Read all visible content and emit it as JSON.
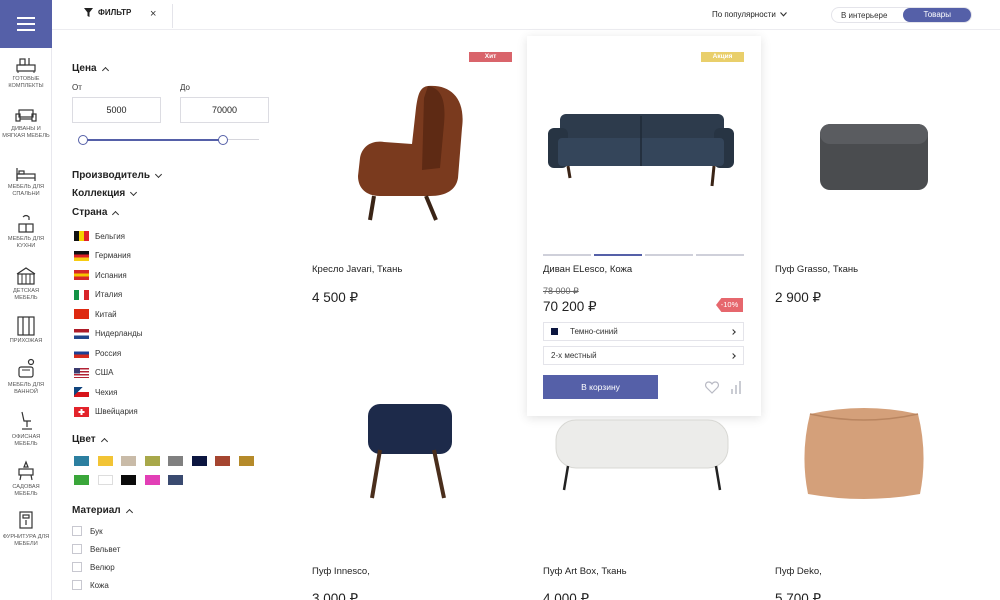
{
  "rail": {
    "items": [
      {
        "label": "ГОТОВЫЕ КОМПЛЕКТЫ",
        "icon": "set-icon"
      },
      {
        "label": "ДИВАНЫ И МЯГКАЯ МЕБЕЛЬ",
        "icon": "sofa-icon"
      },
      {
        "label": "МЕБЕЛЬ ДЛЯ СПАЛЬНИ",
        "icon": "bed-icon"
      },
      {
        "label": "МЕБЕЛЬ ДЛЯ КУХНИ",
        "icon": "kitchen-icon"
      },
      {
        "label": "ДЕТСКАЯ МЕБЕЛЬ",
        "icon": "kids-icon"
      },
      {
        "label": "ПРИХОЖАЯ",
        "icon": "hallway-icon"
      },
      {
        "label": "МЕБЕЛЬ ДЛЯ ВАННОЙ",
        "icon": "bath-icon"
      },
      {
        "label": "ОФИСНАЯ МЕБЕЛЬ",
        "icon": "office-chair-icon"
      },
      {
        "label": "САДОВАЯ МЕБЕЛЬ",
        "icon": "garden-icon"
      },
      {
        "label": "ФУРНИТУРА ДЛЯ МЕБЕЛИ",
        "icon": "hardware-icon"
      }
    ]
  },
  "topbar": {
    "filter_label": "ФИЛЬТР",
    "close": "×",
    "sort_label": "По популярности",
    "view_interior": "В интерьере",
    "view_products": "Товары"
  },
  "filters": {
    "price": {
      "title": "Цена",
      "from_label": "От",
      "to_label": "До",
      "from_value": "5000",
      "to_value": "70000",
      "slider_from_fraction": 0.0,
      "slider_to_fraction": 0.8
    },
    "manufacturer": "Производитель",
    "collection": "Коллекция",
    "country": {
      "title": "Страна",
      "items": [
        {
          "name": "Бельгия",
          "colors": [
            "#111111",
            "#f5d000",
            "#e0202a"
          ],
          "dir": "v"
        },
        {
          "name": "Германия",
          "colors": [
            "#111111",
            "#dd1f26",
            "#f7cc12"
          ],
          "dir": "h"
        },
        {
          "name": "Испания",
          "colors": [
            "#d62828",
            "#f5c400",
            "#d62828"
          ],
          "dir": "h"
        },
        {
          "name": "Италия",
          "colors": [
            "#139245",
            "#ffffff",
            "#d8242a"
          ],
          "dir": "v"
        },
        {
          "name": "Китай",
          "colors": [
            "#de2910"
          ],
          "dir": "h"
        },
        {
          "name": "Нидерланды",
          "colors": [
            "#ae1c28",
            "#ffffff",
            "#21468b"
          ],
          "dir": "h"
        },
        {
          "name": "Россия",
          "colors": [
            "#ffffff",
            "#1c3f94",
            "#d52b1e"
          ],
          "dir": "h"
        },
        {
          "name": "США",
          "colors": [
            "#b22234",
            "#ffffff",
            "#3c3b6e"
          ],
          "dir": "us"
        },
        {
          "name": "Чехия",
          "colors": [
            "#ffffff",
            "#d7141a",
            "#11457e"
          ],
          "dir": "cz"
        },
        {
          "name": "Швейцария",
          "colors": [
            "#e3242b"
          ],
          "dir": "ch"
        }
      ]
    },
    "color": {
      "title": "Цвет",
      "swatches": [
        "#2c7fa0",
        "#f2c435",
        "#c9bba8",
        "#a8a84a",
        "#808080",
        "#0c1640",
        "#a54530",
        "#b58a2a",
        "#3aa63a",
        "#ffffff",
        "#0a0a0a",
        "#e23fb6",
        "#3a4a70"
      ]
    },
    "material": {
      "title": "Материал",
      "items": [
        "Бук",
        "Вельвет",
        "Велюр",
        "Кожа"
      ]
    }
  },
  "products": [
    {
      "name": "Кресло Javari, Ткань",
      "price": "4 500 ₽",
      "badge": "Хит",
      "badge_color": "#d9646b"
    },
    {
      "name": "Диван ELesco, Кожа",
      "price": "70 200 ₽",
      "old_price": "78 000 ₽",
      "discount": "-10%",
      "badge": "Акция",
      "badge_color": "#e9cf6b",
      "options": [
        "Темно-синий",
        "2-х местный"
      ],
      "cart": "В корзину"
    },
    {
      "name": "Пуф Grasso, Ткань",
      "price": "2 900 ₽"
    },
    {
      "name": "Пуф Innesco,",
      "price": "3 000 ₽"
    },
    {
      "name": "Пуф Art Box, Ткань",
      "price": "4 000 ₽"
    },
    {
      "name": "Пуф Deko,",
      "price": "5 700 ₽"
    }
  ],
  "colors": {
    "accent": "#5560a8"
  }
}
